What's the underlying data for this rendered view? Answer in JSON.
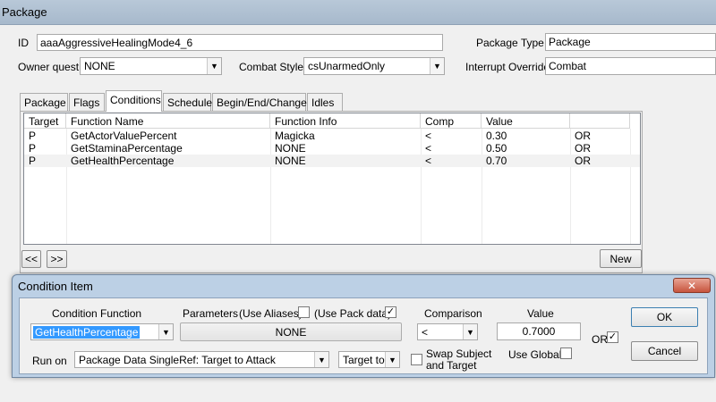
{
  "window": {
    "title": "Package"
  },
  "form": {
    "id_label": "ID",
    "id_value": "aaaAggressiveHealingMode4_6",
    "package_type_label": "Package Type",
    "package_type_value": "Package",
    "owner_quest_label": "Owner quest",
    "owner_quest_value": "NONE",
    "combat_style_label": "Combat Style",
    "combat_style_value": "csUnarmedOnly",
    "interrupt_override_label": "Interrupt Override",
    "interrupt_override_value": "Combat"
  },
  "tabs": [
    "Package",
    "Flags",
    "Conditions",
    "Schedule",
    "Begin/End/Change",
    "Idles"
  ],
  "active_tab": "Conditions",
  "grid": {
    "columns": [
      "Target",
      "Function Name",
      "Function Info",
      "Comp",
      "Value",
      ""
    ],
    "rows": [
      [
        "P",
        "GetActorValuePercent",
        "Magicka",
        "<",
        "0.30",
        "OR"
      ],
      [
        "P",
        "GetStaminaPercentage",
        "NONE",
        "<",
        "0.50",
        "OR"
      ],
      [
        "P",
        "GetHealthPercentage",
        "NONE",
        "<",
        "0.70",
        "OR"
      ]
    ]
  },
  "nav": {
    "prev": "<<",
    "next": ">>",
    "new": "New"
  },
  "dialog": {
    "title": "Condition Item",
    "close": "✕",
    "condition_function_label": "Condition Function",
    "condition_function_value": "GetHealthPercentage",
    "parameters_label": "Parameters",
    "use_aliases_label": "(Use Aliases)",
    "use_aliases_checked": false,
    "use_pack_data_label": "(Use Pack data)",
    "use_pack_data_checked": true,
    "parameter_value": "NONE",
    "comparison_label": "Comparison",
    "comparison_value": "<",
    "value_label": "Value",
    "value_value": "0.7000",
    "or_label": "OR",
    "or_checked": true,
    "ok": "OK",
    "cancel": "Cancel",
    "run_on_label": "Run on",
    "run_on_value": "Package Data SingleRef: Target to Attack",
    "target_value": "Target to",
    "swap_subject_label_1": "Swap Subject",
    "swap_subject_label_2": "and Target",
    "swap_subject_checked": false,
    "use_global_label": "Use Global",
    "use_global_checked": false
  }
}
